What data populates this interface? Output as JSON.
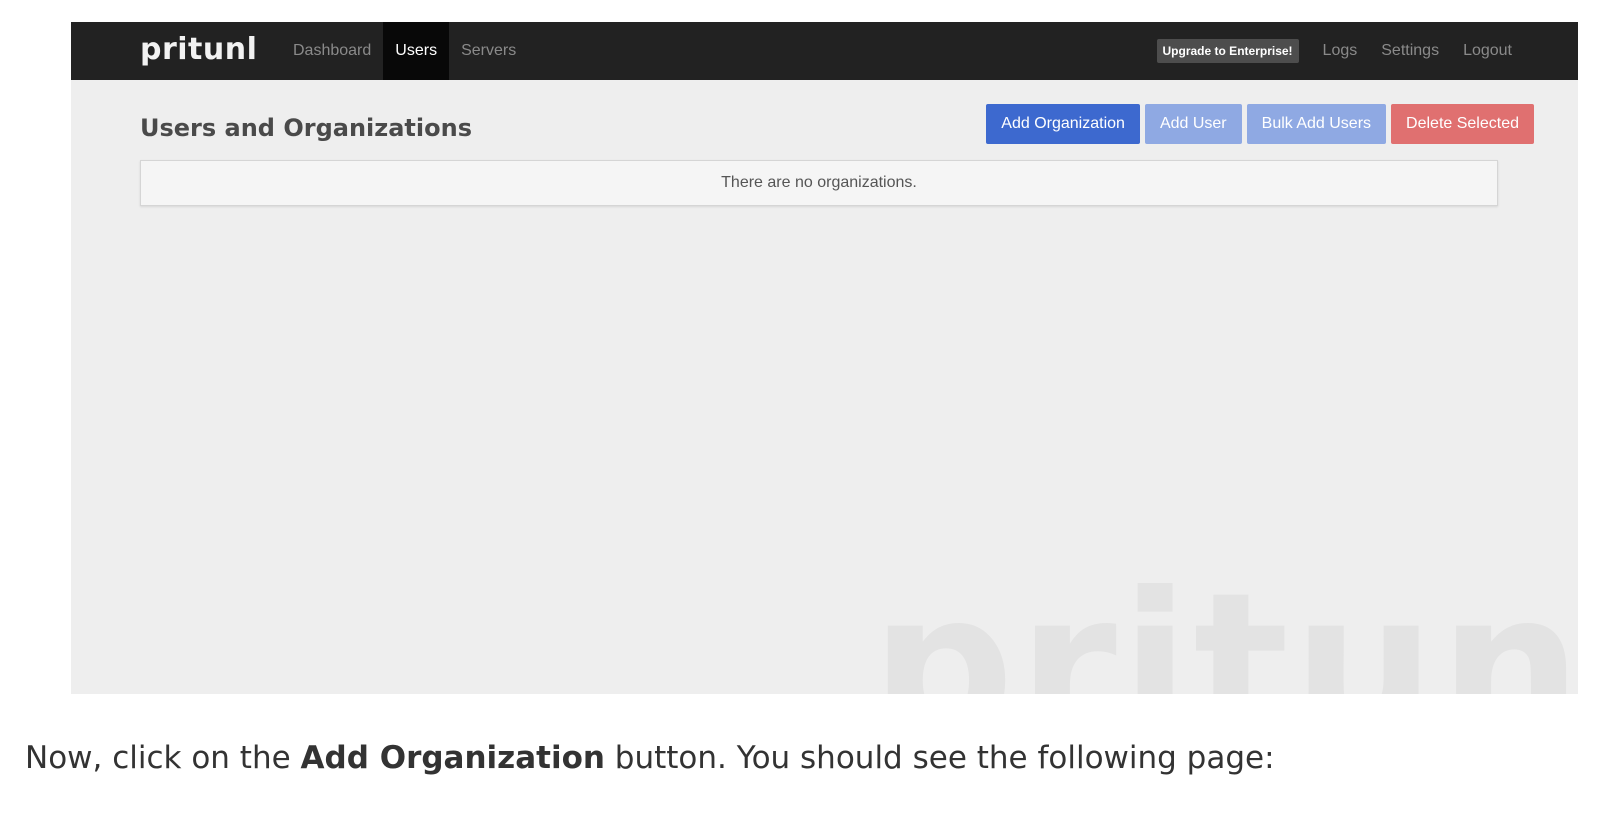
{
  "navbar": {
    "brand": "pritunl",
    "nav_items": [
      {
        "label": "Dashboard",
        "active": false
      },
      {
        "label": "Users",
        "active": true
      },
      {
        "label": "Servers",
        "active": false
      }
    ],
    "upgrade_label": "Upgrade to Enterprise!",
    "right_items": [
      {
        "label": "Logs"
      },
      {
        "label": "Settings"
      },
      {
        "label": "Logout"
      }
    ]
  },
  "main": {
    "title": "Users and Organizations",
    "buttons": {
      "add_organization": "Add Organization",
      "add_user": "Add User",
      "bulk_add_users": "Bulk Add Users",
      "delete_selected": "Delete Selected"
    },
    "empty_message": "There are no organizations.",
    "watermark": "pritunl"
  },
  "caption": {
    "prefix": "Now, click on the ",
    "emphasis": "Add Organization",
    "suffix": " button. You should see the following page:"
  },
  "colors": {
    "navbar_bg": "#222222",
    "primary": "#3d69cf",
    "primary_light": "#8fa9e3",
    "danger": "#e07070",
    "page_bg": "#eeeeee"
  }
}
